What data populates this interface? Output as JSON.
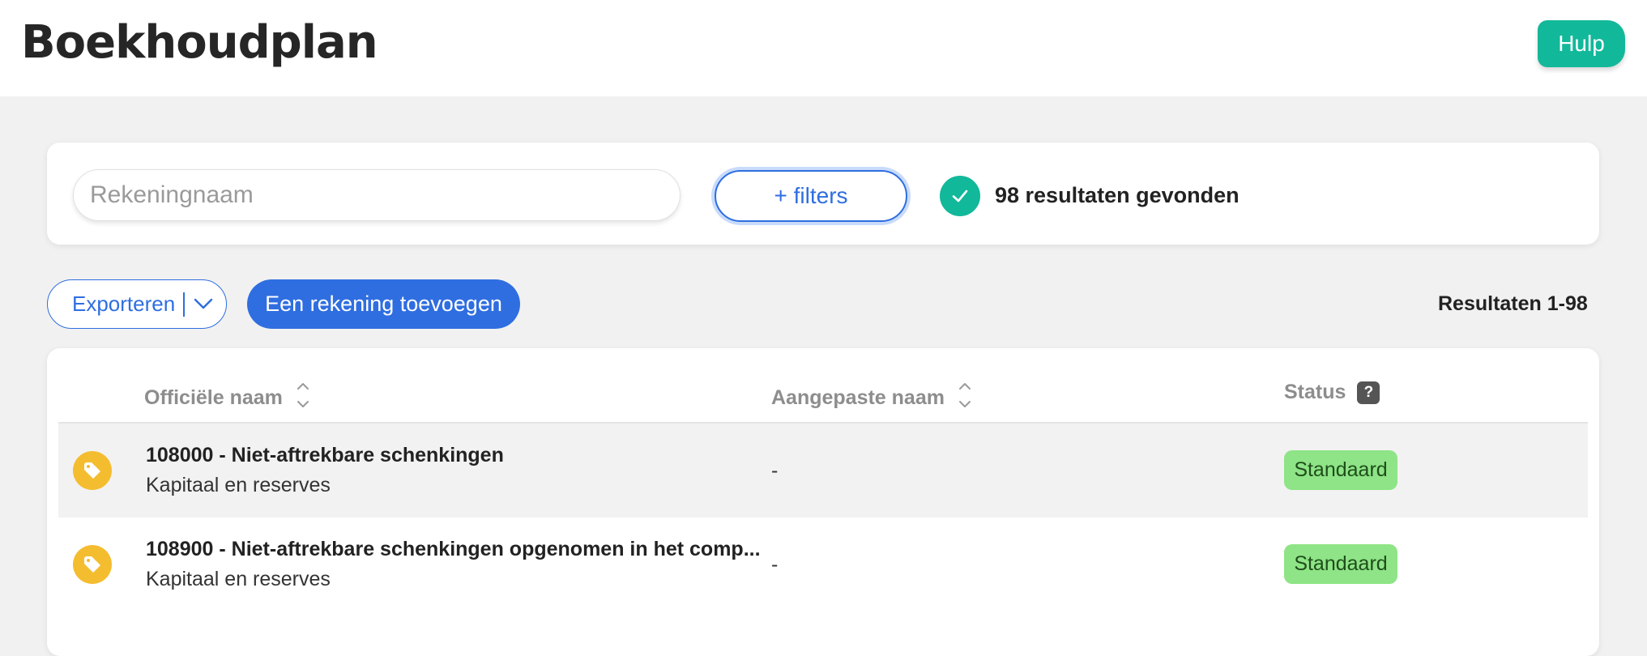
{
  "header": {
    "title": "Boekhoudplan",
    "help_label": "Hulp"
  },
  "search": {
    "placeholder": "Rekeningnaam",
    "filters_label": "+ filters",
    "results_text": "98 resultaten gevonden"
  },
  "toolbar": {
    "export_label": "Exporteren",
    "add_label": "Een rekening toevoegen",
    "results_range": "Resultaten 1-98"
  },
  "table": {
    "columns": [
      "Officiële naam",
      "Aangepaste naam",
      "Status"
    ],
    "status_help": "?",
    "rows": [
      {
        "title": "108000 - Niet-aftrekbare schenkingen",
        "category": "Kapitaal en reserves",
        "custom_name": "-",
        "status": "Standaard"
      },
      {
        "title": "108900 - Niet-aftrekbare schenkingen opgenomen in het comp...",
        "category": "Kapitaal en reserves",
        "custom_name": "-",
        "status": "Standaard"
      }
    ]
  },
  "colors": {
    "accent_blue": "#2f6ee0",
    "accent_green": "#12b89a",
    "status_green": "#8ee486",
    "tag_yellow": "#f4bd30"
  },
  "icons": {
    "result_status": "check-icon",
    "export_dropdown": "chevron-down-icon",
    "sort": "sort-icon",
    "row_type": "tag-icon"
  }
}
